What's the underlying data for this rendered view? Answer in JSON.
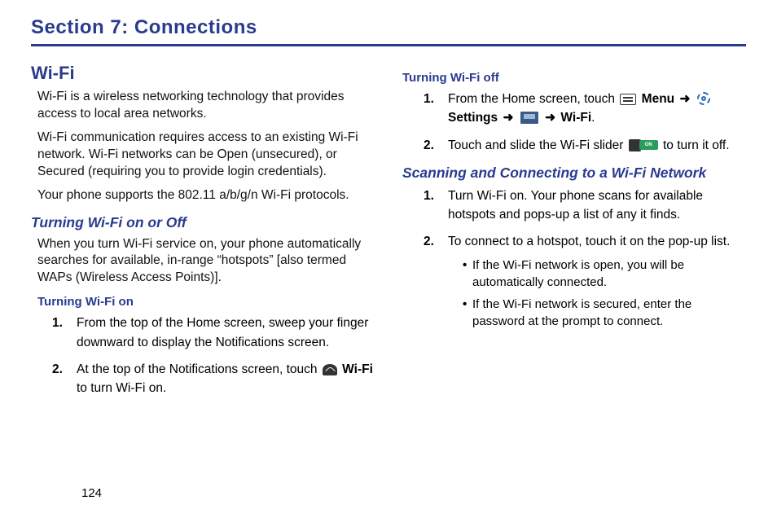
{
  "sectionTitle": "Section 7: Connections",
  "pageNumber": "124",
  "left": {
    "h1": "Wi-Fi",
    "p1": "Wi-Fi is a wireless networking technology that provides access to local area networks.",
    "p2": "Wi-Fi communication requires access to an existing Wi-Fi network. Wi-Fi networks can be Open (unsecured), or Secured (requiring you to provide login credentials).",
    "p3": "Your phone supports the 802.11 a/b/g/n Wi-Fi protocols.",
    "h2a": "Turning Wi-Fi on or Off",
    "p4": "When you turn Wi-Fi service on, your phone automatically searches for available, in-range “hotspots” [also termed WAPs (Wireless Access Points)].",
    "h3a": "Turning Wi-Fi on",
    "step1": "From the top of the Home screen, sweep your finger downward to display the Notifications screen.",
    "step2a": "At the top of the Notifications screen, touch ",
    "step2b": "Wi-Fi",
    "step2c": " to turn Wi-Fi on."
  },
  "right": {
    "h3b": "Turning Wi-Fi off",
    "off1a": "From the Home screen, touch ",
    "off1menu": "Menu",
    "off1settings": "Settings",
    "off1wifi": "Wi-Fi",
    "arrow": "➜",
    "off2a": "Touch and slide the Wi-Fi slider ",
    "off2b": " to turn it off.",
    "h2b": "Scanning and Connecting to a Wi-Fi Network",
    "scan1": "Turn Wi-Fi on. Your phone scans for available hotspots and pops-up a list of any it finds.",
    "scan2": "To connect to a hotspot, touch it on the pop-up list.",
    "bullet1": "If the Wi-Fi network is open, you will be automatically connected.",
    "bullet2": "If the Wi-Fi network is secured, enter the password at the prompt to connect.",
    "sliderText": "ON"
  }
}
